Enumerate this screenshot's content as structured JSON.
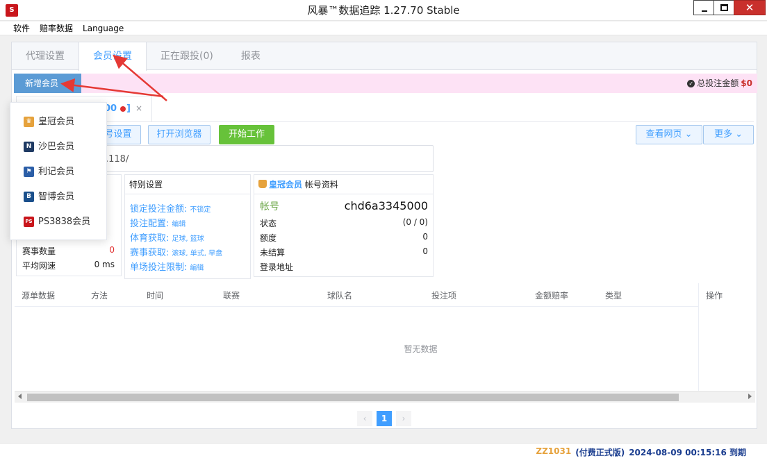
{
  "window": {
    "title": "风暴™数据追踪 1.27.70 Stable",
    "logo_text": "S",
    "close_glyph": "✕"
  },
  "menu": [
    "软件",
    "赔率数据",
    "Language"
  ],
  "tabs": [
    {
      "label": "代理设置",
      "active": false
    },
    {
      "label": "会员设置",
      "active": true
    },
    {
      "label": "正在跟投(0)",
      "active": false
    },
    {
      "label": "报表",
      "active": false
    }
  ],
  "toolbar": {
    "add_member": "新增会员",
    "add_member_chevron": "⌄",
    "total_label": "总投注金额",
    "total_value": "$0",
    "check_glyph": "✓"
  },
  "account_tab": {
    "label_fragment": "00",
    "bracket": "]",
    "close": "×"
  },
  "buttons": {
    "account_settings_fragment": "号设置",
    "open_browser": "打开浏览器",
    "start_work": "开始工作",
    "view_web": "查看网页 ⌄",
    "more": "更多 ⌄"
  },
  "url_fragment": ".118/",
  "stats": [
    {
      "label": "赛事数量",
      "value": "0"
    },
    {
      "label": "平均网速",
      "value": "0 ms"
    }
  ],
  "special": {
    "title": "特别设置",
    "rows": [
      {
        "label": "锁定投注金额:",
        "sub": "不锁定"
      },
      {
        "label": "投注配置:",
        "sub": "编辑"
      },
      {
        "label": "体育获取:",
        "sub": "足球, 篮球"
      },
      {
        "label": "赛事获取:",
        "sub": "滚球, 单式, 早盘"
      },
      {
        "label": "单场投注限制:",
        "sub": "编辑"
      }
    ]
  },
  "account_info": {
    "brand": "皇冠会员",
    "title": "帐号资料",
    "rows": [
      {
        "label": "帐号",
        "value": "chd6a3345000"
      },
      {
        "label": "状态",
        "value": "(0 / 0)"
      },
      {
        "label": "额度",
        "value": "0"
      },
      {
        "label": "未结算",
        "value": "0"
      },
      {
        "label": "登录地址",
        "value": ""
      }
    ]
  },
  "table": {
    "headers": [
      "源单数据",
      "方法",
      "时间",
      "联赛",
      "球队名",
      "投注项",
      "金额赔率",
      "类型",
      "操作"
    ],
    "empty_text": "暂无数据"
  },
  "pager": {
    "prev": "‹",
    "current": "1",
    "next": "›"
  },
  "dropdown": [
    {
      "label": "皇冠会员",
      "icon": "crown-icon",
      "color": "#e6a23c",
      "glyph": "♛"
    },
    {
      "label": "沙巴会员",
      "icon": "saba-icon",
      "color": "#1f3a63",
      "glyph": "N"
    },
    {
      "label": "利记会员",
      "icon": "sbo-icon",
      "color": "#2b5ea7",
      "glyph": "⚑"
    },
    {
      "label": "智博会员",
      "icon": "zhibo-icon",
      "color": "#1a4f8b",
      "glyph": "B"
    },
    {
      "label": "PS3838会员",
      "icon": "ps3838-icon",
      "color": "#c9161c",
      "glyph": "PS"
    }
  ],
  "status": {
    "code": "ZZ1031",
    "edition": "(付费正式版)",
    "expiry": "2024-08-09 00:15:16 到期"
  },
  "colors": {
    "accent": "#409eff",
    "notice_bg": "#fde2f5",
    "start_btn": "#67c23a",
    "arrow_red": "#e53935"
  }
}
